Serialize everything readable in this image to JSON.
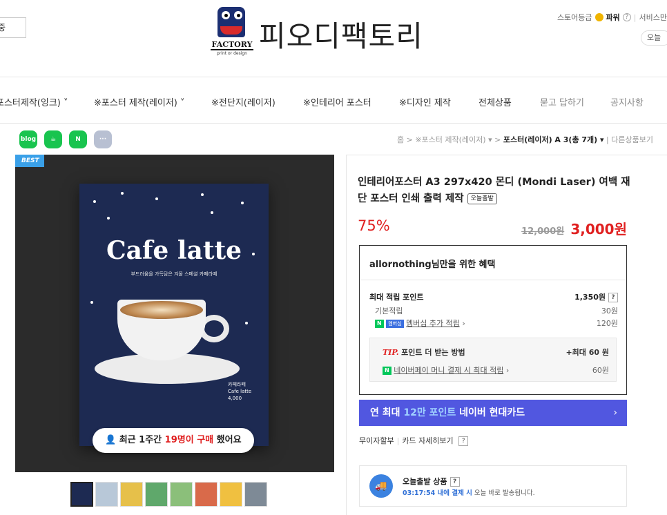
{
  "header": {
    "search_partial": "중",
    "logo_factory": "FACTORY",
    "logo_sub": "print or design",
    "logo_text": "피오디팩토리",
    "store_grade_label": "스토어등급",
    "store_grade_value": "파워",
    "service_partial": "서비스만",
    "today_partial": "오늘"
  },
  "nav": {
    "items": [
      "포스터제작(잉크) ˅",
      "※포스터 제작(레이저) ˅",
      "※전단지(레이저)",
      "※인테리어 포스터",
      "※디자인 제작",
      "전체상품",
      "묻고 답하기",
      "공지사항"
    ]
  },
  "share": [
    "blog",
    "talk",
    "N",
    "···"
  ],
  "breadcrumb": {
    "home": "홈",
    "cat": "※포스터 제작(레이저) ▾",
    "current": "포스터(레이저) A 3(총 7개) ▾",
    "other": "다른상품보기"
  },
  "image": {
    "badge": "BEST",
    "poster_title": "Cafe latte",
    "poster_subtitle": "부드러움을 가득담은 겨울 스페셜 카페라떼",
    "poster_price_name": "카페라떼",
    "poster_price_en": "Cafe latte",
    "poster_price_value": "4,000",
    "buy_pre": "최근 1주간 ",
    "buy_count": "19명이 구매",
    "buy_post": " 했어요"
  },
  "product": {
    "title": "인테리어포스터 A3 297x420 몬디 (Mondi Laser) 여백 재단 포스터 인쇄 출력 제작",
    "today_tag": "오늘출발",
    "discount": "75%",
    "original_price": "12,000원",
    "sale_price": "3,000원"
  },
  "benefit": {
    "title": "allornothing님만을 위한 혜택",
    "max_points_label": "최대 적립 포인트",
    "max_points_value": "1,350원",
    "basic_label": "기본적립",
    "basic_value": "30원",
    "membership_link": "멤버십 추가 적립",
    "membership_value": "120원",
    "tip_label": "TIP.",
    "tip_text": "포인트 더 받는 방법",
    "tip_max": "+최대 60 원",
    "npay_link": "네이버페이 머니 결제 시 최대 적립",
    "npay_value": "60원",
    "n_badge": "N",
    "mem_badge": "멤버십",
    "q": "?"
  },
  "card_banner": {
    "pre": "연 최대 ",
    "highlight": "12만 포인트",
    "post": " 네이버 현대카드",
    "arrow": "›"
  },
  "installment": {
    "label": "무이자할부",
    "link": "카드 자세히보기",
    "q": "?"
  },
  "shipping": {
    "title": "오늘출발 상품",
    "time": "03:17:54 내에 결제 시",
    "desc": " 오늘 바로 발송됩니다.",
    "q": "?"
  },
  "colors": {
    "accent_red": "#e02020",
    "card_blue": "#5157e0",
    "naver_green": "#03c75a",
    "best_blue": "#3aa0e8"
  }
}
